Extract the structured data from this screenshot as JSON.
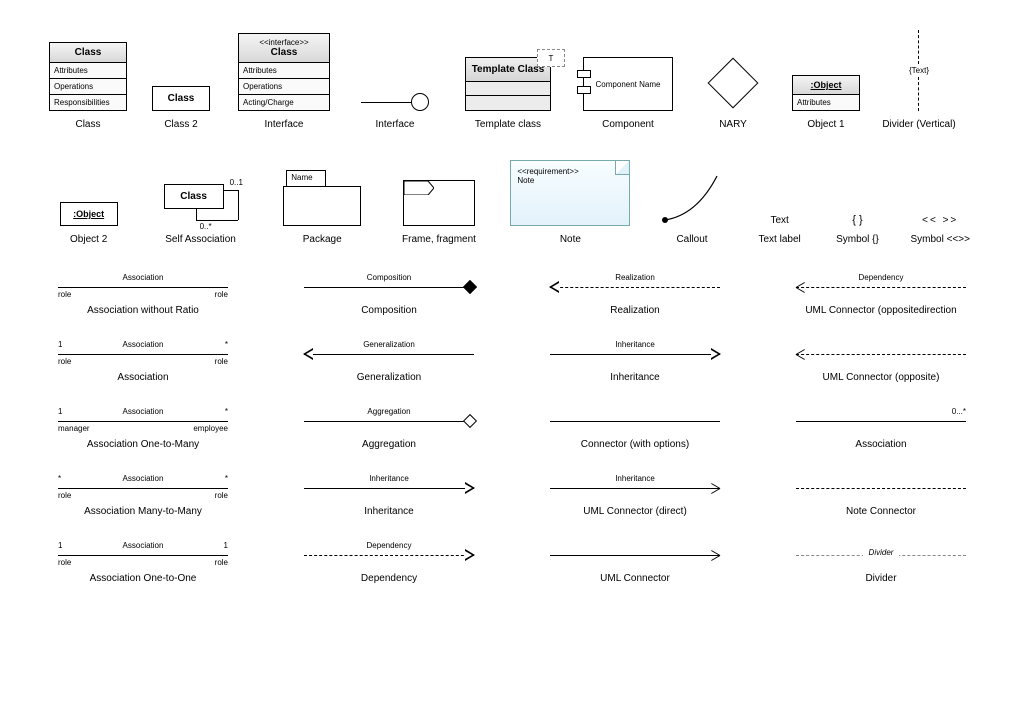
{
  "row1": {
    "class": {
      "title": "Class",
      "rows": [
        "Attributes",
        "Operations",
        "Responsibilities"
      ],
      "label": "Class"
    },
    "class2": {
      "title": "Class",
      "label": "Class 2"
    },
    "interface": {
      "stereo": "<<interface>>",
      "title": "Class",
      "rows": [
        "Attributes",
        "Operations",
        "Acting/Charge"
      ],
      "label": "Interface"
    },
    "lollipop": {
      "label": "Interface"
    },
    "template": {
      "param": "T",
      "title": "Template Class",
      "label": "Template class"
    },
    "component": {
      "text": "Component Name",
      "label": "Component"
    },
    "nary": {
      "label": "NARY"
    },
    "object1": {
      "title": ":Object",
      "row": "Attributes",
      "label": "Object 1"
    },
    "divider": {
      "text": "{Text}",
      "label": "Divider (Vertical)"
    }
  },
  "row2": {
    "object2": {
      "title": ":Object",
      "label": "Object 2"
    },
    "selfassoc": {
      "title": "Class",
      "m1": "0..1",
      "m2": "0..*",
      "label": "Self Association"
    },
    "package": {
      "tab": "Name",
      "label": "Package"
    },
    "frame": {
      "label": "Frame, fragment"
    },
    "note": {
      "stereo": "<<requirement>>",
      "text": "Note",
      "label": "Note"
    },
    "callout": {
      "label": "Callout"
    },
    "text": {
      "content": "Text",
      "label": "Text label"
    },
    "braces": {
      "content": "{ }",
      "label": "Symbol {}"
    },
    "guill": {
      "content": "<<  >>",
      "label": "Symbol <<>>"
    }
  },
  "connectors": [
    [
      {
        "caption": "Association without Ratio",
        "top": "Association",
        "bl": "role",
        "br": "role",
        "style": "solid"
      },
      {
        "caption": "Composition",
        "top": "Composition",
        "style": "solid",
        "end": "filled-diamond"
      },
      {
        "caption": "Realization",
        "top": "Realization",
        "style": "dash",
        "start": "open-tri"
      },
      {
        "caption": "UML Connector (oppositedirection",
        "top": "Dependency",
        "style": "dash",
        "start": "simple"
      }
    ],
    [
      {
        "caption": "Association",
        "top": "Association",
        "tl": "1",
        "tr": "*",
        "bl": "role",
        "br": "role",
        "style": "solid"
      },
      {
        "caption": "Generalization",
        "top": "Generalization",
        "style": "solid",
        "start": "open-tri"
      },
      {
        "caption": "Inheritance",
        "top": "Inheritance",
        "style": "solid",
        "end": "open-tri"
      },
      {
        "caption": "UML Connector (opposite)",
        "style": "dash",
        "start": "simple"
      }
    ],
    [
      {
        "caption": "Association One-to-Many",
        "top": "Association",
        "tl": "1",
        "tr": "*",
        "bl": "manager",
        "br": "employee",
        "style": "solid"
      },
      {
        "caption": "Aggregation",
        "top": "Aggregation",
        "style": "solid",
        "end": "open-diamond"
      },
      {
        "caption": "Connector (with options)",
        "style": "solid"
      },
      {
        "caption": "Association",
        "tr": "0...*",
        "style": "solid"
      }
    ],
    [
      {
        "caption": "Association Many-to-Many",
        "top": "Association",
        "tl": "*",
        "tr": "*",
        "bl": "role",
        "br": "role",
        "style": "solid"
      },
      {
        "caption": "Inheritance",
        "top": "Inheritance",
        "style": "solid",
        "end": "open-tri"
      },
      {
        "caption": "UML Connector (direct)",
        "top": "Inheritance",
        "style": "solid",
        "end": "simple"
      },
      {
        "caption": "Note Connector",
        "style": "dash"
      }
    ],
    [
      {
        "caption": "Association One-to-One",
        "top": "Association",
        "tl": "1",
        "tr": "1",
        "bl": "role",
        "br": "role",
        "style": "solid"
      },
      {
        "caption": "Dependency",
        "top": "Dependency",
        "style": "dash",
        "end": "open-tri"
      },
      {
        "caption": "UML Connector",
        "style": "solid",
        "end": "simple"
      },
      {
        "caption": "Divider",
        "style": "hdiv",
        "top": "Divider"
      }
    ]
  ]
}
